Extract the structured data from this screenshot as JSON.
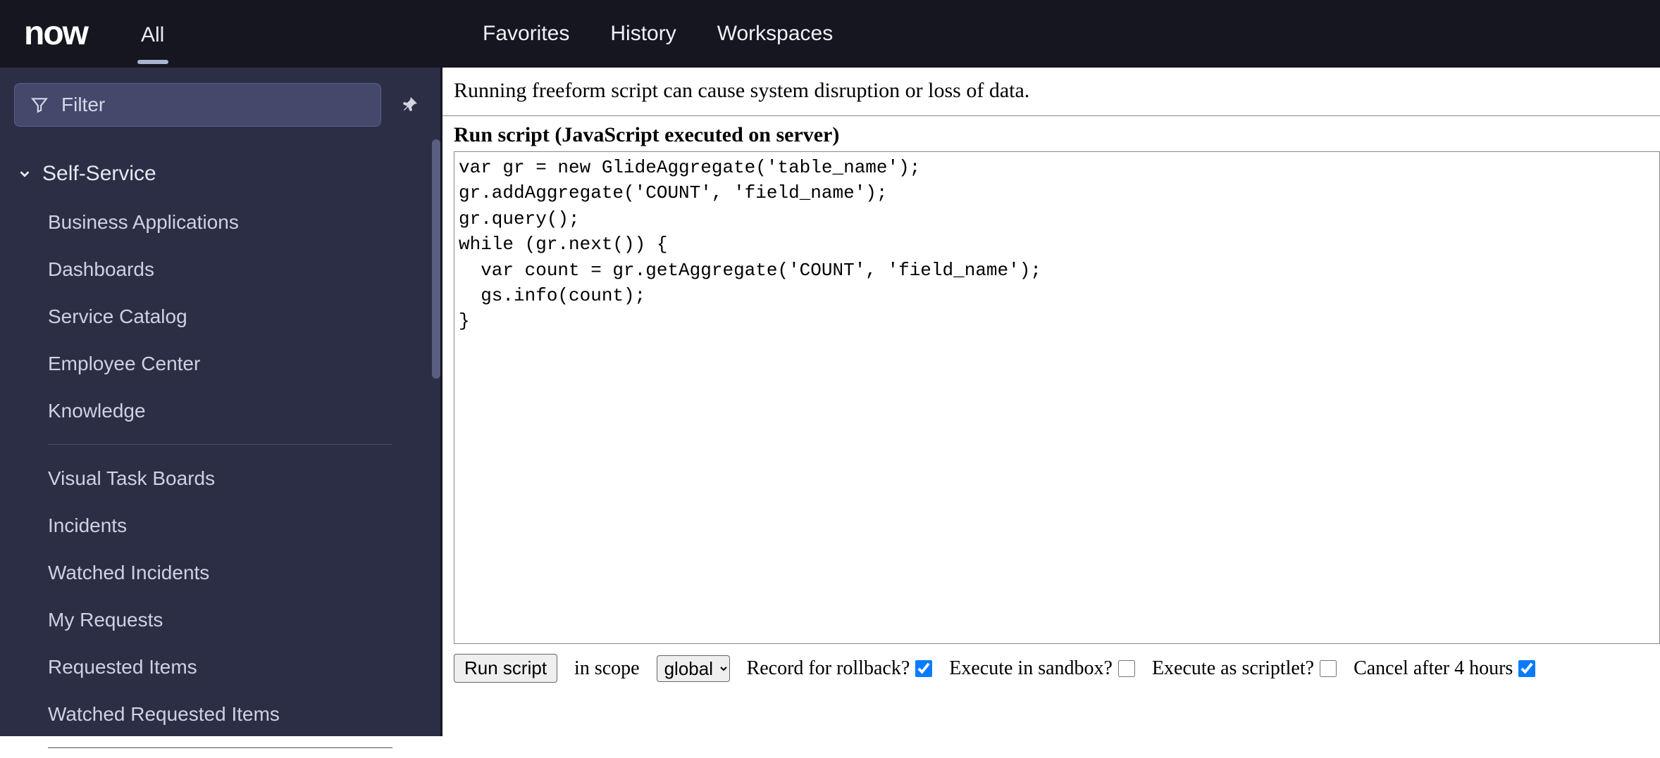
{
  "logo": "now",
  "topnav": {
    "all": "All",
    "favorites": "Favorites",
    "history": "History",
    "workspaces": "Workspaces"
  },
  "sidebar": {
    "filter_placeholder": "Filter",
    "section_title": "Self-Service",
    "items_a": [
      "Business Applications",
      "Dashboards",
      "Service Catalog",
      "Employee Center",
      "Knowledge"
    ],
    "items_b": [
      "Visual Task Boards",
      "Incidents",
      "Watched Incidents",
      "My Requests",
      "Requested Items",
      "Watched Requested Items"
    ]
  },
  "main": {
    "warning": "Running freeform script can cause system disruption or loss of data.",
    "section_title": "Run script (JavaScript executed on server)",
    "script": "var gr = new GlideAggregate('table_name');\ngr.addAggregate('COUNT', 'field_name');\ngr.query();\nwhile (gr.next()) {\n  var count = gr.getAggregate('COUNT', 'field_name');\n  gs.info(count);\n}",
    "controls": {
      "run_label": "Run script",
      "in_scope_label": "in scope",
      "scope_selected": "global",
      "record_rollback_label": "Record for rollback?",
      "record_rollback_checked": true,
      "execute_sandbox_label": "Execute in sandbox?",
      "execute_sandbox_checked": false,
      "execute_scriptlet_label": "Execute as scriptlet?",
      "execute_scriptlet_checked": false,
      "cancel_after_label": "Cancel after 4 hours",
      "cancel_after_checked": true
    }
  }
}
